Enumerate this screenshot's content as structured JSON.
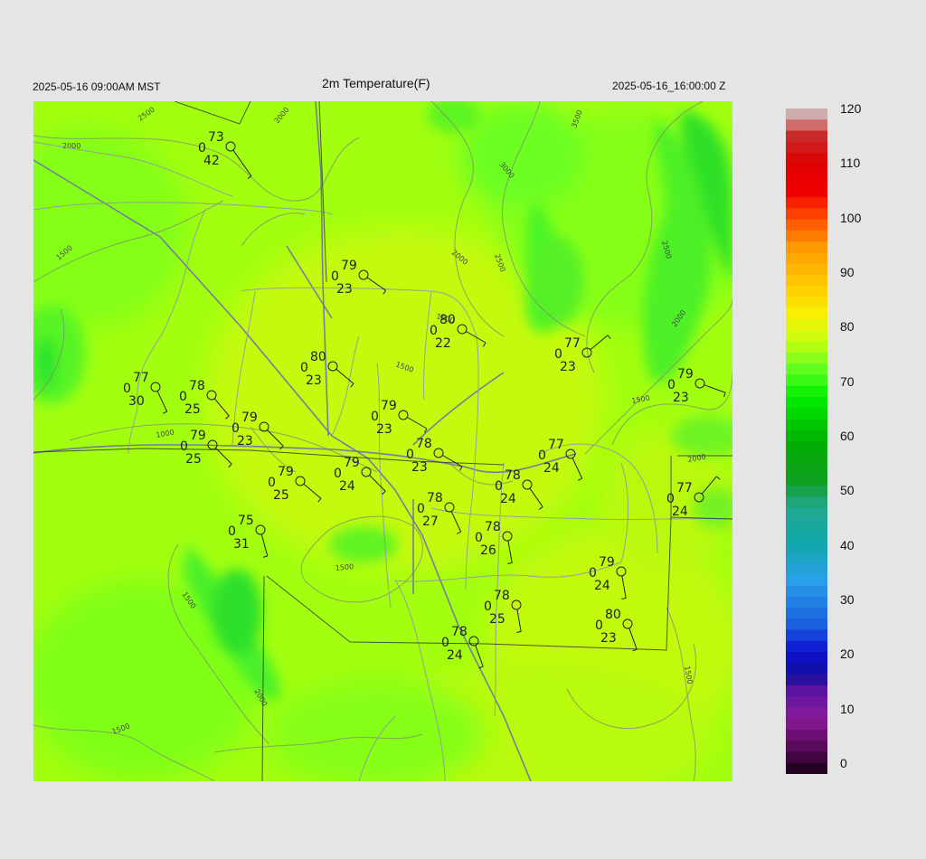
{
  "header": {
    "valid_local": "2025-05-16 09:00AM MST",
    "title": "2m Temperature(F)",
    "valid_utc": "2025-05-16_16:00:00 Z"
  },
  "colorbar": {
    "ticks": [
      "120",
      "110",
      "100",
      "90",
      "80",
      "70",
      "60",
      "50",
      "40",
      "30",
      "20",
      "10",
      "0"
    ],
    "min": 0,
    "max": 120,
    "stops": [
      {
        "v": 0,
        "c": "#160016"
      },
      {
        "v": 5,
        "c": "#5a0a5a"
      },
      {
        "v": 10,
        "c": "#8a1a9a"
      },
      {
        "v": 15,
        "c": "#5a14a0"
      },
      {
        "v": 18,
        "c": "#1010a0"
      },
      {
        "v": 22,
        "c": "#1010d0"
      },
      {
        "v": 27,
        "c": "#1a60e0"
      },
      {
        "v": 35,
        "c": "#2aa0e8"
      },
      {
        "v": 42,
        "c": "#10a8a8"
      },
      {
        "v": 48,
        "c": "#22a890"
      },
      {
        "v": 53,
        "c": "#10a020"
      },
      {
        "v": 60,
        "c": "#00b000"
      },
      {
        "v": 68,
        "c": "#00f000"
      },
      {
        "v": 73,
        "c": "#60ff20"
      },
      {
        "v": 78,
        "c": "#c8ff10"
      },
      {
        "v": 83,
        "c": "#f8f000"
      },
      {
        "v": 88,
        "c": "#ffcc00"
      },
      {
        "v": 95,
        "c": "#ff9900"
      },
      {
        "v": 100,
        "c": "#ff5000"
      },
      {
        "v": 105,
        "c": "#f00000"
      },
      {
        "v": 110,
        "c": "#e00000"
      },
      {
        "v": 115,
        "c": "#c82a2a"
      },
      {
        "v": 118,
        "c": "#d28c8c"
      },
      {
        "v": 120,
        "c": "#cccccc"
      }
    ]
  },
  "contour_labels": [
    "2000",
    "2500",
    "2000",
    "1500",
    "3000",
    "3500",
    "2500",
    "2000",
    "2500",
    "2000",
    "1500",
    "1500",
    "1000",
    "1500",
    "1500",
    "2000",
    "1500",
    "1500",
    "1500",
    "2000"
  ],
  "stations": [
    {
      "t": "73",
      "d": "42",
      "c": "0"
    },
    {
      "t": "79",
      "d": "23",
      "c": "0"
    },
    {
      "t": "80",
      "d": "22",
      "c": "0"
    },
    {
      "t": "77",
      "d": "23",
      "c": "0"
    },
    {
      "t": "79",
      "d": "23",
      "c": "0"
    },
    {
      "t": "80",
      "d": "23",
      "c": "0"
    },
    {
      "t": "77",
      "d": "30",
      "c": "0"
    },
    {
      "t": "78",
      "d": "25",
      "c": "0"
    },
    {
      "t": "79",
      "d": "23",
      "c": "0"
    },
    {
      "t": "79",
      "d": "23",
      "c": "0"
    },
    {
      "t": "79",
      "d": "25",
      "c": "0"
    },
    {
      "t": "78",
      "d": "23",
      "c": "0"
    },
    {
      "t": "77",
      "d": "24",
      "c": "0"
    },
    {
      "t": "79",
      "d": "24",
      "c": "0"
    },
    {
      "t": "79",
      "d": "25",
      "c": "0"
    },
    {
      "t": "78",
      "d": "24",
      "c": "0"
    },
    {
      "t": "77",
      "d": "24",
      "c": "0"
    },
    {
      "t": "78",
      "d": "27",
      "c": "0"
    },
    {
      "t": "75",
      "d": "31",
      "c": "0"
    },
    {
      "t": "78",
      "d": "26",
      "c": "0"
    },
    {
      "t": "79",
      "d": "24",
      "c": "0"
    },
    {
      "t": "78",
      "d": "25",
      "c": "0"
    },
    {
      "t": "80",
      "d": "23",
      "c": "0"
    },
    {
      "t": "78",
      "d": "24",
      "c": "0"
    }
  ]
}
